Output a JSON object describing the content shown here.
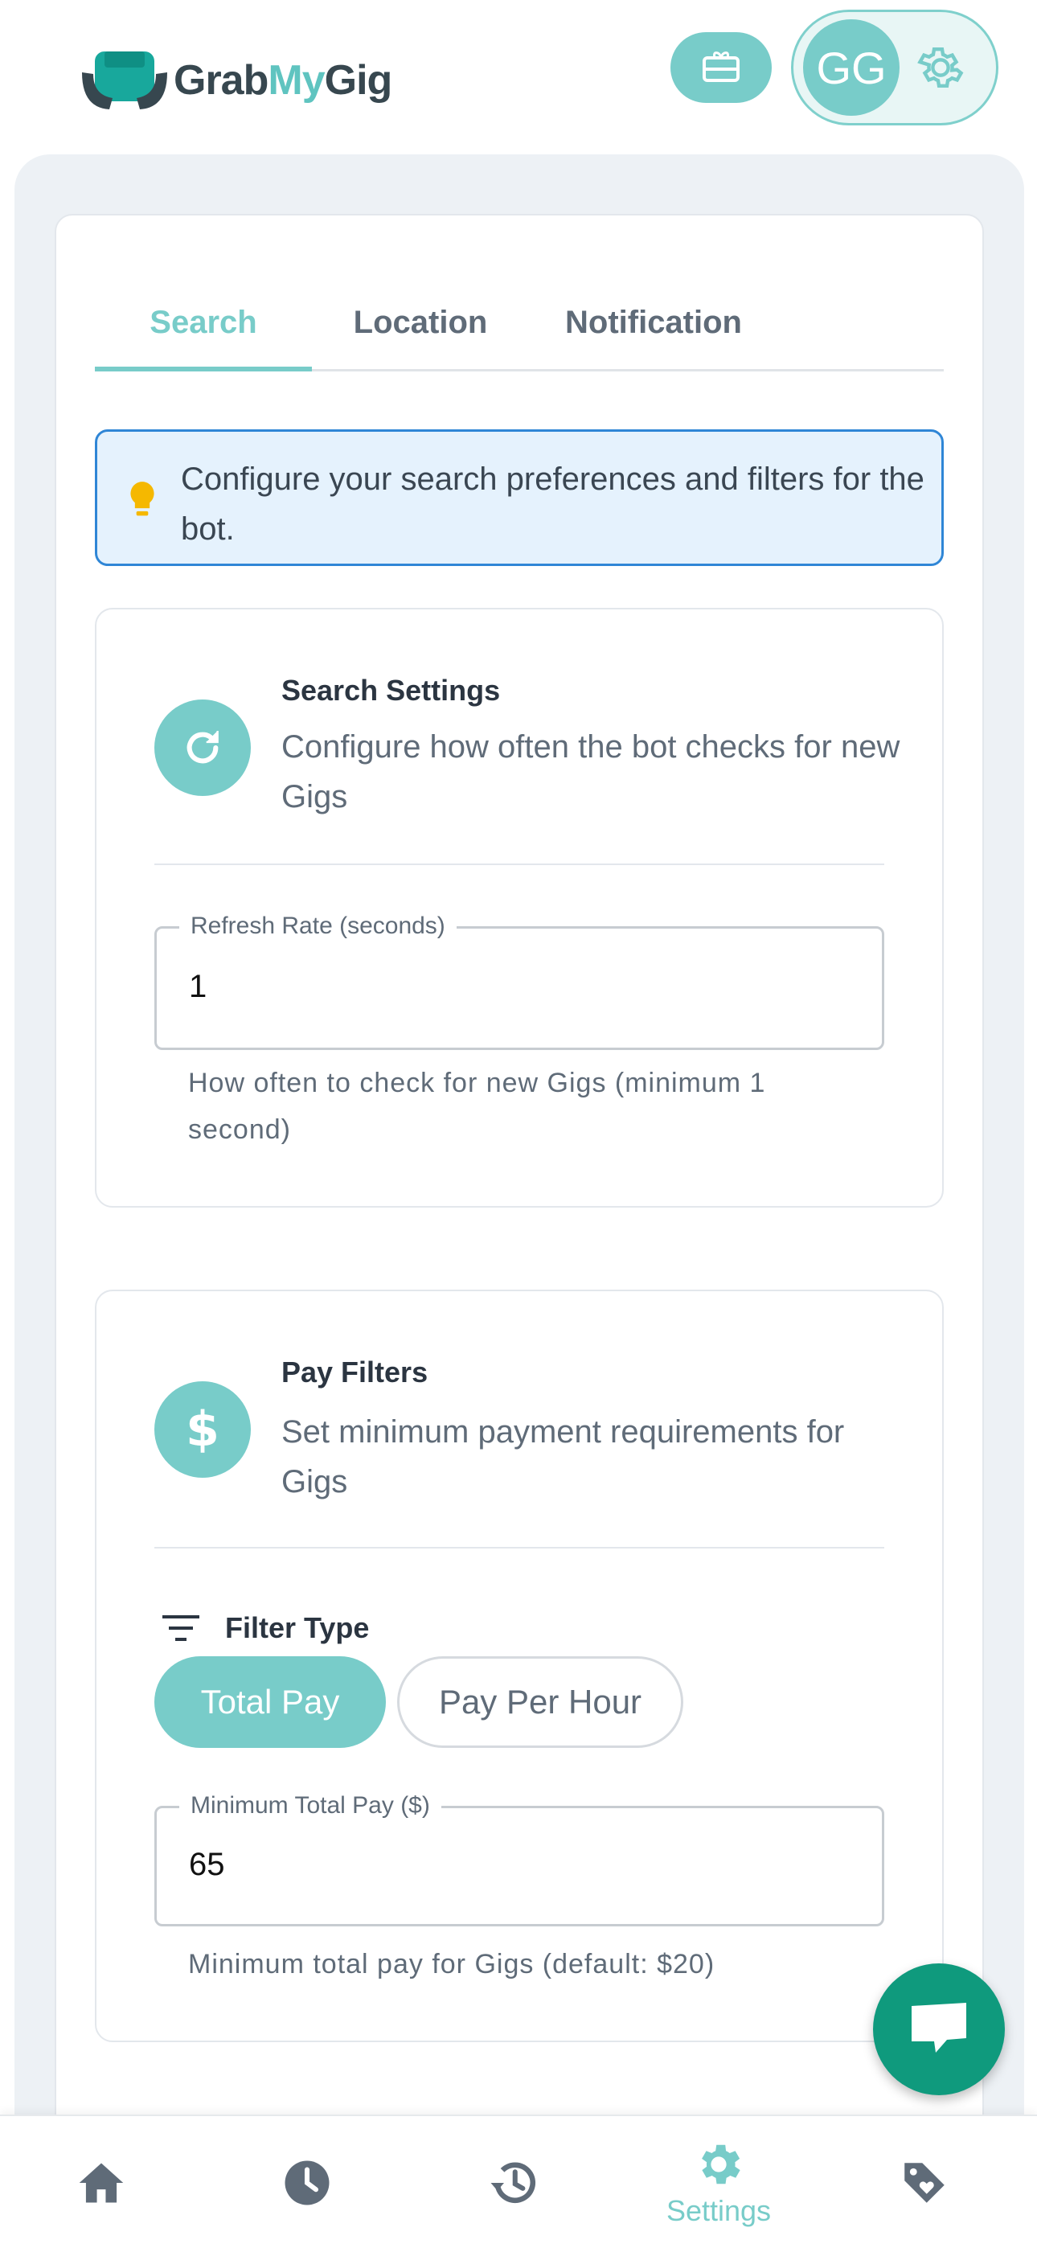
{
  "app": {
    "logo": {
      "grab": "Grab",
      "my": "My",
      "gig": "Gig"
    },
    "avatar_initials": "GG"
  },
  "tabs": [
    {
      "label": "Search",
      "active": true
    },
    {
      "label": "Location",
      "active": false
    },
    {
      "label": "Notification",
      "active": false
    }
  ],
  "info": {
    "text": "Configure your search preferences and filters for the bot."
  },
  "search_settings": {
    "title": "Search Settings",
    "description": "Configure how often the bot checks for new Gigs",
    "field_label": "Refresh Rate (seconds)",
    "field_value": "1",
    "helper": "How often to check for new Gigs (minimum 1 second)"
  },
  "pay_filters": {
    "title": "Pay Filters",
    "description": "Set minimum payment requirements for Gigs",
    "filter_type_label": "Filter Type",
    "options": [
      "Total Pay",
      "Pay Per Hour"
    ],
    "selected": "Total Pay",
    "field_label": "Minimum Total Pay ($)",
    "field_value": "65",
    "helper": "Minimum total pay for Gigs (default: $20)"
  },
  "bottom_nav": {
    "items": [
      {
        "icon": "home-icon",
        "label": ""
      },
      {
        "icon": "clock-icon",
        "label": ""
      },
      {
        "icon": "history-icon",
        "label": ""
      },
      {
        "icon": "gear-icon",
        "label": "Settings"
      },
      {
        "icon": "tag-heart-icon",
        "label": ""
      }
    ]
  },
  "colors": {
    "accent": "#78ccc9",
    "fab": "#0f9a7d",
    "info_border": "#2f86d6",
    "info_bg": "#e5f2fd"
  }
}
